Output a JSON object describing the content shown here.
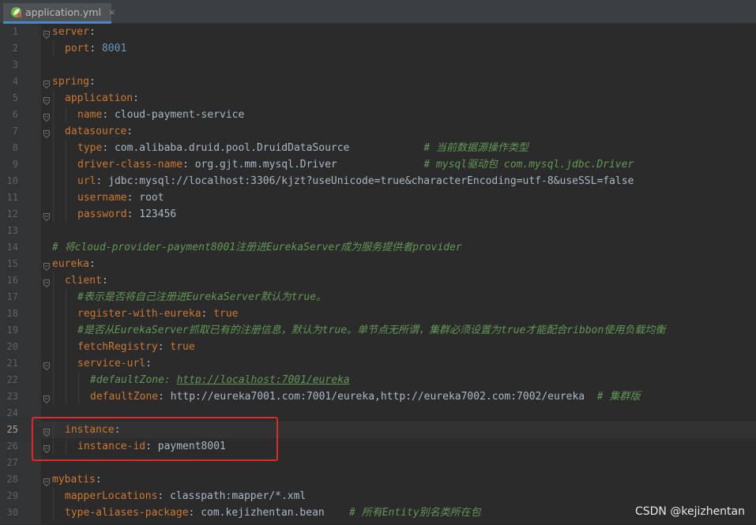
{
  "tab": {
    "icon": "spring-leaf-icon",
    "label": "application.yml",
    "close_label": "×"
  },
  "colors": {
    "key": "#cc7832",
    "number": "#6897bb",
    "value": "#a9b7c6",
    "comment": "#629755",
    "highlight_border": "#e02a2a"
  },
  "current_line": 25,
  "highlighted_lines": [
    25,
    26
  ],
  "lines": [
    {
      "n": "1",
      "indent": 0,
      "fold": true,
      "segs": [
        {
          "t": "server",
          "c": "k"
        },
        {
          "t": ":",
          "c": "p"
        }
      ]
    },
    {
      "n": "2",
      "indent": 1,
      "fold": false,
      "segs": [
        {
          "t": "port",
          "c": "k"
        },
        {
          "t": ": ",
          "c": "p"
        },
        {
          "t": "8001",
          "c": "n"
        }
      ]
    },
    {
      "n": "3",
      "indent": 0,
      "fold": false,
      "segs": []
    },
    {
      "n": "4",
      "indent": 0,
      "fold": true,
      "segs": [
        {
          "t": "spring",
          "c": "k"
        },
        {
          "t": ":",
          "c": "p"
        }
      ]
    },
    {
      "n": "5",
      "indent": 1,
      "fold": true,
      "segs": [
        {
          "t": "application",
          "c": "k"
        },
        {
          "t": ":",
          "c": "p"
        }
      ]
    },
    {
      "n": "6",
      "indent": 2,
      "fold": true,
      "segs": [
        {
          "t": "name",
          "c": "k"
        },
        {
          "t": ": ",
          "c": "p"
        },
        {
          "t": "cloud-payment-service",
          "c": "v"
        }
      ]
    },
    {
      "n": "7",
      "indent": 1,
      "fold": true,
      "segs": [
        {
          "t": "datasource",
          "c": "k"
        },
        {
          "t": ":",
          "c": "p"
        }
      ]
    },
    {
      "n": "8",
      "indent": 2,
      "fold": false,
      "segs": [
        {
          "t": "type",
          "c": "k"
        },
        {
          "t": ": ",
          "c": "p"
        },
        {
          "t": "com.alibaba.druid.pool.DruidDataSource            ",
          "c": "v"
        },
        {
          "t": "# 当前数据源操作类型",
          "c": "c"
        }
      ]
    },
    {
      "n": "9",
      "indent": 2,
      "fold": false,
      "segs": [
        {
          "t": "driver-class-name",
          "c": "k"
        },
        {
          "t": ": ",
          "c": "p"
        },
        {
          "t": "org.gjt.mm.mysql.Driver              ",
          "c": "v"
        },
        {
          "t": "# mysql驱动包 com.mysql.jdbc.Driver",
          "c": "c"
        }
      ]
    },
    {
      "n": "10",
      "indent": 2,
      "fold": false,
      "segs": [
        {
          "t": "url",
          "c": "k"
        },
        {
          "t": ": ",
          "c": "p"
        },
        {
          "t": "jdbc:mysql://localhost:3306/kjzt?useUnicode=true&characterEncoding=utf-8&useSSL=false",
          "c": "v"
        }
      ]
    },
    {
      "n": "11",
      "indent": 2,
      "fold": false,
      "segs": [
        {
          "t": "username",
          "c": "k"
        },
        {
          "t": ": ",
          "c": "p"
        },
        {
          "t": "root",
          "c": "v"
        }
      ]
    },
    {
      "n": "12",
      "indent": 2,
      "fold": true,
      "segs": [
        {
          "t": "password",
          "c": "k"
        },
        {
          "t": ": ",
          "c": "p"
        },
        {
          "t": "123456",
          "c": "v"
        }
      ]
    },
    {
      "n": "13",
      "indent": 0,
      "fold": false,
      "segs": []
    },
    {
      "n": "14",
      "indent": 0,
      "fold": false,
      "segs": [
        {
          "t": "# 将cloud-provider-payment8001注册进EurekaServer成为服务提供者provider",
          "c": "c"
        }
      ]
    },
    {
      "n": "15",
      "indent": 0,
      "fold": true,
      "segs": [
        {
          "t": "eureka",
          "c": "k"
        },
        {
          "t": ":",
          "c": "p"
        }
      ]
    },
    {
      "n": "16",
      "indent": 1,
      "fold": true,
      "segs": [
        {
          "t": "client",
          "c": "k"
        },
        {
          "t": ":",
          "c": "p"
        }
      ]
    },
    {
      "n": "17",
      "indent": 2,
      "fold": false,
      "segs": [
        {
          "t": "#表示是否将自己注册进EurekaServer默认为true。",
          "c": "c"
        }
      ]
    },
    {
      "n": "18",
      "indent": 2,
      "fold": false,
      "segs": [
        {
          "t": "register-with-eureka",
          "c": "k"
        },
        {
          "t": ": ",
          "c": "p"
        },
        {
          "t": "true",
          "c": "k"
        }
      ]
    },
    {
      "n": "19",
      "indent": 2,
      "fold": false,
      "segs": [
        {
          "t": "#是否从EurekaServer抓取已有的注册信息，默认为true。单节点无所谓，集群必须设置为true才能配合ribbon使用负载均衡",
          "c": "c"
        }
      ]
    },
    {
      "n": "20",
      "indent": 2,
      "fold": false,
      "segs": [
        {
          "t": "fetchRegistry",
          "c": "k"
        },
        {
          "t": ": ",
          "c": "p"
        },
        {
          "t": "true",
          "c": "k"
        }
      ]
    },
    {
      "n": "21",
      "indent": 2,
      "fold": true,
      "segs": [
        {
          "t": "service-url",
          "c": "k"
        },
        {
          "t": ":",
          "c": "p"
        }
      ]
    },
    {
      "n": "22",
      "indent": 3,
      "fold": false,
      "segs": [
        {
          "t": "#defaultZone: ",
          "c": "c"
        },
        {
          "t": "http://localhost:7001/eureka",
          "c": "c u"
        }
      ]
    },
    {
      "n": "23",
      "indent": 3,
      "fold": true,
      "segs": [
        {
          "t": "defaultZone",
          "c": "k"
        },
        {
          "t": ": ",
          "c": "p"
        },
        {
          "t": "http://eureka7001.com:7001/eureka,http://eureka7002.com:7002/eureka  ",
          "c": "v"
        },
        {
          "t": "# 集群版",
          "c": "c"
        }
      ]
    },
    {
      "n": "24",
      "indent": 0,
      "fold": false,
      "segs": []
    },
    {
      "n": "25",
      "indent": 1,
      "fold": true,
      "segs": [
        {
          "t": "instance",
          "c": "k"
        },
        {
          "t": ":",
          "c": "p"
        }
      ]
    },
    {
      "n": "26",
      "indent": 2,
      "fold": true,
      "segs": [
        {
          "t": "instance-id",
          "c": "k"
        },
        {
          "t": ": ",
          "c": "p"
        },
        {
          "t": "payment8001",
          "c": "v"
        }
      ]
    },
    {
      "n": "27",
      "indent": 0,
      "fold": false,
      "segs": []
    },
    {
      "n": "28",
      "indent": 0,
      "fold": true,
      "segs": [
        {
          "t": "mybatis",
          "c": "k"
        },
        {
          "t": ":",
          "c": "p"
        }
      ]
    },
    {
      "n": "29",
      "indent": 1,
      "fold": false,
      "segs": [
        {
          "t": "mapperLocations",
          "c": "k"
        },
        {
          "t": ": ",
          "c": "p"
        },
        {
          "t": "classpath:mapper/*.xml",
          "c": "v"
        }
      ]
    },
    {
      "n": "30",
      "indent": 1,
      "fold": false,
      "segs": [
        {
          "t": "type-aliases-package",
          "c": "k"
        },
        {
          "t": ": ",
          "c": "p"
        },
        {
          "t": "com.kejizhentan.bean    ",
          "c": "v"
        },
        {
          "t": "# 所有Entity别名类所在包",
          "c": "c"
        }
      ]
    }
  ],
  "watermark": "CSDN @kejizhentan"
}
